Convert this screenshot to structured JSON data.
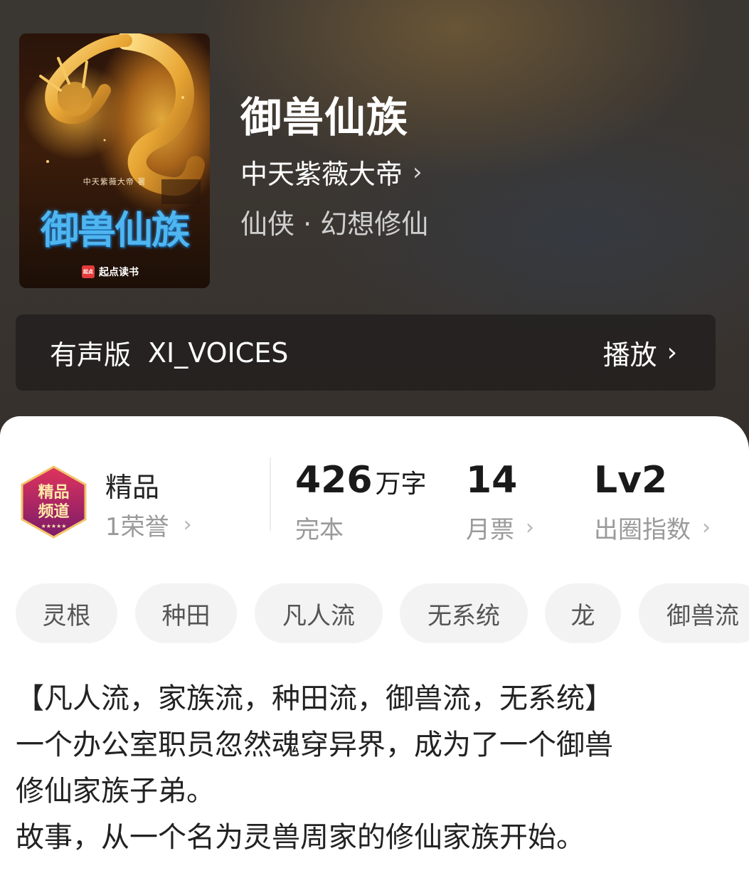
{
  "colors": {
    "hero_bg": "#3a3632",
    "cover_title": "#4fb6f0",
    "tag_bg": "#f3f3f3",
    "muted_text": "#9a9a9a",
    "badge_red": "#c0244a"
  },
  "cover": {
    "author_small": "中天紫薇大帝 著",
    "title": "御兽仙族",
    "publisher": "起点读书",
    "publisher_logo": "起点"
  },
  "book": {
    "title": "御兽仙族",
    "author": "中天紫薇大帝",
    "genre": "仙侠 · 幻想修仙"
  },
  "audio": {
    "label": "有声版",
    "voice": "XI_VOICES",
    "play_label": "播放"
  },
  "badge": {
    "image_text": [
      "精品",
      "频道"
    ],
    "title": "精品",
    "honor": "1荣誉"
  },
  "stats": [
    {
      "value": "426",
      "unit": "万字",
      "label": "完本"
    },
    {
      "value": "14",
      "unit": "",
      "label": "月票"
    },
    {
      "value": "Lv2",
      "unit": "",
      "label": "出圈指数"
    }
  ],
  "tags": [
    "灵根",
    "种田",
    "凡人流",
    "无系统",
    "龙",
    "御兽流"
  ],
  "description": [
    "【凡人流，家族流，种田流，御兽流，无系统】",
    "一个办公室职员忽然魂穿异界，成为了一个御兽",
    "修仙家族子弟。",
    "故事，从一个名为灵兽周家的修仙家族开始。"
  ]
}
